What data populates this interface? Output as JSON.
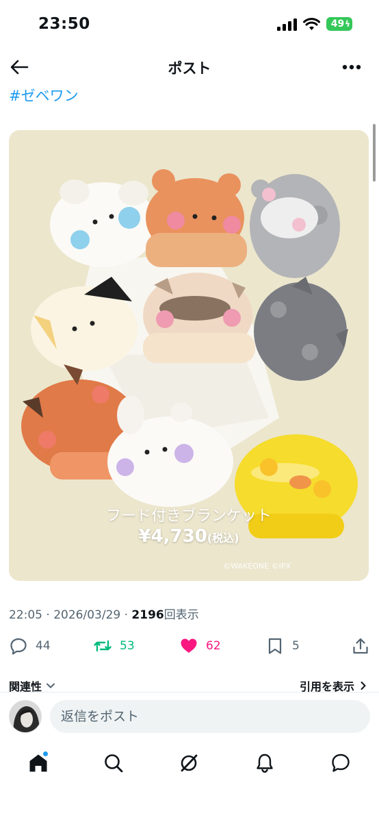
{
  "status_bar": {
    "time": "23:50",
    "battery": "49"
  },
  "topbar": {
    "title": "ポスト"
  },
  "post": {
    "hashtag": "#ゼベワン",
    "media": {
      "product_name": "フード付きブランケット",
      "price": "¥4,730",
      "price_tax": "(税込)",
      "copyright": "©WAKEONE ©IPX"
    },
    "time": "22:05",
    "date": "2026/03/29",
    "views_count": "2196",
    "views_label": "回表示",
    "sep": " · "
  },
  "actions": {
    "replies": "44",
    "retweets": "53",
    "likes": "62",
    "bookmarks": "5"
  },
  "related": {
    "label": "関連性",
    "quotes_label": "引用を表示"
  },
  "reply_bar": {
    "placeholder": "返信をポスト"
  },
  "colors": {
    "accent": "#1d9bf0",
    "retweet": "#00ba7c",
    "like": "#f91880",
    "battery": "#34c759"
  }
}
